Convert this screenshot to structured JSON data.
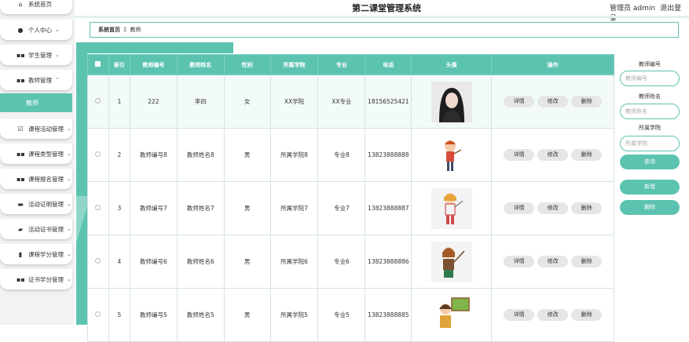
{
  "topbar": {
    "title": "第二课堂管理系统",
    "user_label": "管理员 admin",
    "logout_label": "退出登录"
  },
  "sidebar": {
    "items": [
      {
        "label": "系统首页",
        "icon": "home-icon"
      },
      {
        "label": "个人中心",
        "icon": "user-icon"
      },
      {
        "label": "学生管理",
        "icon": "grid-icon"
      },
      {
        "label": "教师管理",
        "icon": "grid-icon"
      },
      {
        "label": "课程活动管理",
        "icon": "check-icon"
      },
      {
        "label": "课程类型管理",
        "icon": "grid-icon"
      },
      {
        "label": "课程报名管理",
        "icon": "grid-icon"
      },
      {
        "label": "活动证明管理",
        "icon": "briefcase-icon"
      },
      {
        "label": "活动证书管理",
        "icon": "cert-icon"
      },
      {
        "label": "课程学分管理",
        "icon": "bar-chart-icon"
      },
      {
        "label": "证书学分管理",
        "icon": "grid-icon"
      }
    ],
    "active_sub": "教师"
  },
  "breadcrumb": {
    "home": "系统首页",
    "sep": "Ξ",
    "current": "教师"
  },
  "table": {
    "headers": [
      "索引",
      "教师编号",
      "教师姓名",
      "性别",
      "所属学院",
      "专业",
      "电话",
      "头像",
      "操作"
    ],
    "rows": [
      {
        "idx": "1",
        "no": "222",
        "name": "李四",
        "sex": "女",
        "college": "XX学院",
        "major": "XX专业",
        "phone": "18156525421",
        "avatar": "photo"
      },
      {
        "idx": "2",
        "no": "教师编号8",
        "name": "教师姓名8",
        "sex": "男",
        "college": "所属学院8",
        "major": "专业8",
        "phone": "13823888888",
        "avatar": "cartoon1"
      },
      {
        "idx": "3",
        "no": "教师编号7",
        "name": "教师姓名7",
        "sex": "男",
        "college": "所属学院7",
        "major": "专业7",
        "phone": "13823888887",
        "avatar": "cartoon2"
      },
      {
        "idx": "4",
        "no": "教师编号6",
        "name": "教师姓名6",
        "sex": "男",
        "college": "所属学院6",
        "major": "专业6",
        "phone": "13823888886",
        "avatar": "cartoon3"
      },
      {
        "idx": "5",
        "no": "教师编号5",
        "name": "教师姓名5",
        "sex": "男",
        "college": "所属学院5",
        "major": "专业5",
        "phone": "13823888885",
        "avatar": "cartoon4"
      }
    ],
    "actions": {
      "detail": "详情",
      "edit": "修改",
      "delete": "删除"
    }
  },
  "search_panel": {
    "no_label": "教师编号",
    "no_placeholder": "教师编号",
    "name_label": "教师姓名",
    "name_placeholder": "教师姓名",
    "college_label": "所属学院",
    "college_placeholder": "所属学院",
    "query_button": "查询",
    "add_button": "新增",
    "delete_button": "删除"
  },
  "colors": {
    "accent": "#5cc3b1"
  }
}
